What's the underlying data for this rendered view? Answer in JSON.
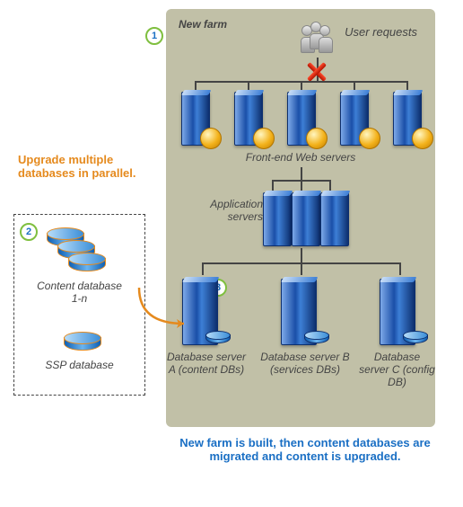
{
  "steps": {
    "s1": "1",
    "s2": "2",
    "s3": "3"
  },
  "farm": {
    "title": "New farm",
    "user_requests": "User requests",
    "front_end_label": "Front-end Web servers",
    "app_label": "Application servers",
    "db_a": "Database server A (content DBs)",
    "db_b": "Database server B (services DBs)",
    "db_c": "Database server C (config DB)"
  },
  "notes": {
    "orange": "Upgrade multiple databases in parallel.",
    "blue": "New farm is built, then content databases are migrated and content is upgraded."
  },
  "left_panel": {
    "content_db": "Content database 1-n",
    "ssp_db": "SSP database"
  }
}
